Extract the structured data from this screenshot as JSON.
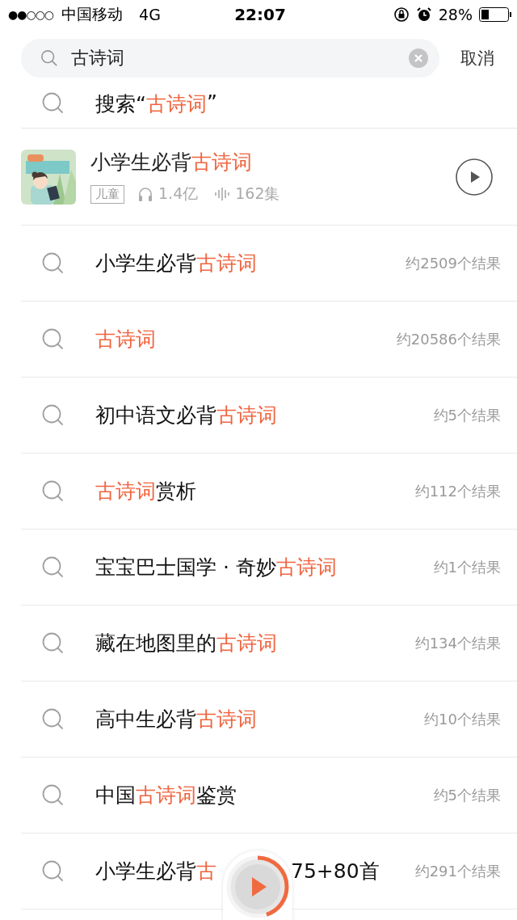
{
  "status_bar": {
    "signal": "●●○○○",
    "carrier": "中国移动",
    "network": "4G",
    "time": "22:07",
    "battery": "28%"
  },
  "search": {
    "value": "古诗词",
    "cancel": "取消"
  },
  "results": [
    {
      "kind": "search_all",
      "title": [
        {
          "text": "搜索“"
        },
        {
          "text": "古诗词",
          "highlight": true
        },
        {
          "text": "”"
        }
      ]
    },
    {
      "kind": "album",
      "title": [
        {
          "text": "小学生必背"
        },
        {
          "text": "古诗词",
          "highlight": true
        }
      ],
      "tag": "儿童",
      "plays": "1.4亿",
      "episodes": "162集"
    },
    {
      "kind": "query",
      "title": [
        {
          "text": "小学生必背"
        },
        {
          "text": "古诗词",
          "highlight": true
        }
      ],
      "count": "约2509个结果"
    },
    {
      "kind": "query",
      "title": [
        {
          "text": "古诗词",
          "highlight": true
        }
      ],
      "count": "约20586个结果"
    },
    {
      "kind": "query",
      "title": [
        {
          "text": "初中语文必背"
        },
        {
          "text": "古诗词",
          "highlight": true
        }
      ],
      "count": "约5个结果"
    },
    {
      "kind": "query",
      "title": [
        {
          "text": "古诗词",
          "highlight": true
        },
        {
          "text": "赏析"
        }
      ],
      "count": "约112个结果"
    },
    {
      "kind": "query",
      "title": [
        {
          "text": "宝宝巴士国学 · 奇妙"
        },
        {
          "text": "古诗词",
          "highlight": true
        }
      ],
      "count": "约1个结果"
    },
    {
      "kind": "query",
      "title": [
        {
          "text": "藏在地图里的"
        },
        {
          "text": "古诗词",
          "highlight": true
        }
      ],
      "count": "约134个结果"
    },
    {
      "kind": "query",
      "title": [
        {
          "text": "高中生必背"
        },
        {
          "text": "古诗词",
          "highlight": true
        }
      ],
      "count": "约10个结果"
    },
    {
      "kind": "query",
      "title": [
        {
          "text": "中国"
        },
        {
          "text": "古诗词",
          "highlight": true
        },
        {
          "text": "鉴赏"
        }
      ],
      "count": "约5个结果"
    },
    {
      "kind": "query",
      "title": [
        {
          "text": "小学生必背"
        },
        {
          "text": "古",
          "highlight": true
        },
        {
          "kind": "gap"
        },
        {
          "text": "75+80首"
        }
      ],
      "count": "约291个结果"
    }
  ],
  "player": {
    "level": 0.45
  }
}
